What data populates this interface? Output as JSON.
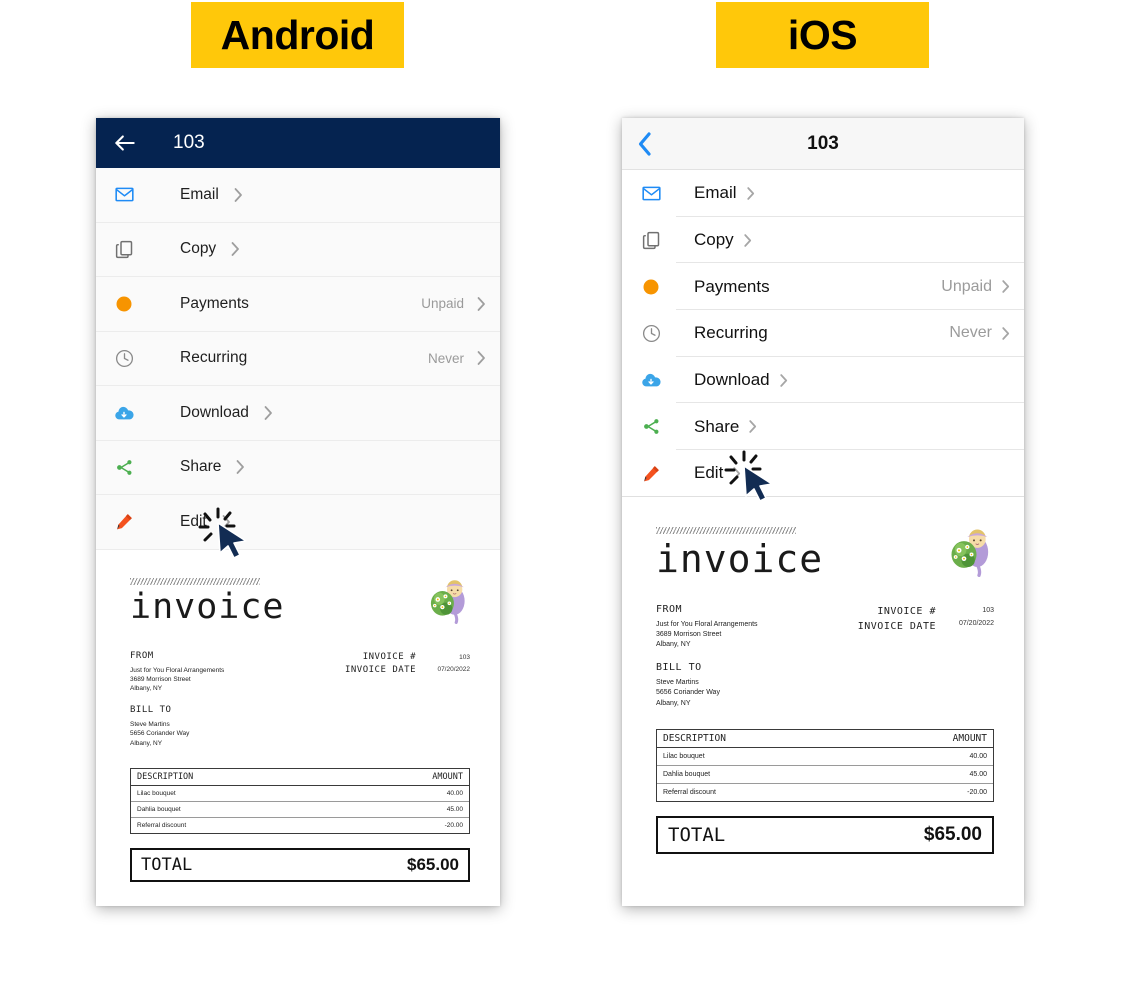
{
  "badges": {
    "android": "Android",
    "ios": "iOS"
  },
  "colors": {
    "badge_yellow": "#FFC80A",
    "android_header_navy": "#052350",
    "ios_accent_blue": "#1f8bf5",
    "payments_orange": "#F79400",
    "download_blue": "#3BA5E8",
    "share_green": "#4CAF50",
    "edit_red": "#F4511E"
  },
  "android": {
    "header": {
      "back_icon": "arrow-left-icon",
      "title": "103"
    },
    "rows": [
      {
        "icon": "envelope-icon",
        "label": "Email",
        "value": "",
        "chevron": "chevron-right-icon"
      },
      {
        "icon": "copy-icon",
        "label": "Copy",
        "value": "",
        "chevron": "chevron-right-icon"
      },
      {
        "icon": "circle-icon",
        "label": "Payments",
        "value": "Unpaid",
        "chevron": "chevron-right-icon"
      },
      {
        "icon": "clock-icon",
        "label": "Recurring",
        "value": "Never",
        "chevron": "chevron-right-icon"
      },
      {
        "icon": "cloud-download-icon",
        "label": "Download",
        "value": "",
        "chevron": "chevron-right-icon"
      },
      {
        "icon": "share-icon",
        "label": "Share",
        "value": "",
        "chevron": "chevron-right-icon"
      },
      {
        "icon": "pencil-icon",
        "label": "Edit",
        "value": "",
        "chevron": "chevron-right-icon"
      }
    ]
  },
  "ios": {
    "header": {
      "back_icon": "chevron-left-icon",
      "title": "103"
    },
    "rows": [
      {
        "icon": "envelope-icon",
        "label": "Email",
        "value": "",
        "chevron": "chevron-right-icon"
      },
      {
        "icon": "copy-icon",
        "label": "Copy",
        "value": "",
        "chevron": "chevron-right-icon"
      },
      {
        "icon": "circle-icon",
        "label": "Payments",
        "value": "Unpaid",
        "chevron": "chevron-right-icon"
      },
      {
        "icon": "clock-icon",
        "label": "Recurring",
        "value": "Never",
        "chevron": "chevron-right-icon"
      },
      {
        "icon": "cloud-download-icon",
        "label": "Download",
        "value": "",
        "chevron": "chevron-right-icon"
      },
      {
        "icon": "share-icon",
        "label": "Share",
        "value": "",
        "chevron": "chevron-right-icon"
      },
      {
        "icon": "pencil-icon",
        "label": "Edit",
        "value": "",
        "chevron": "chevron-right-icon"
      }
    ]
  },
  "invoice": {
    "word": "invoice",
    "logo_icon": "florist-girl-bouquet-illustration",
    "from_label": "FROM",
    "from_lines": [
      "Just for You Floral Arrangements",
      "3689 Morrison Street",
      "Albany, NY"
    ],
    "bill_to_label": "BILL TO",
    "bill_to_lines": [
      "Steve Martins",
      "5656 Coriander Way",
      "Albany, NY"
    ],
    "meta_labels": [
      "INVOICE #",
      "INVOICE DATE"
    ],
    "meta_values": [
      "103",
      "07/20/2022"
    ],
    "table": {
      "headers": [
        "DESCRIPTION",
        "AMOUNT"
      ],
      "rows": [
        {
          "description": "Lilac bouquet",
          "amount": "40.00"
        },
        {
          "description": "Dahlia bouquet",
          "amount": "45.00"
        },
        {
          "description": "Referral discount",
          "amount": "-20.00"
        }
      ]
    },
    "total_label": "TOTAL",
    "total_value": "$65.00"
  },
  "cursor": {
    "icon": "mouse-pointer-click-icon"
  }
}
